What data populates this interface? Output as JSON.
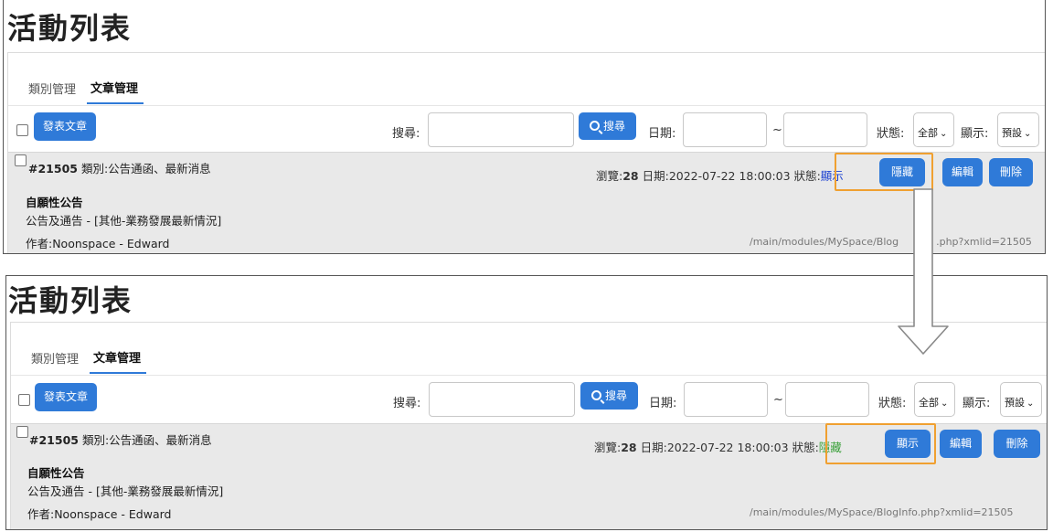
{
  "page": {
    "title": "活動列表",
    "tabs": [
      "類別管理",
      "文章管理"
    ],
    "publish_button": "發表文章",
    "search_label": "搜尋:",
    "search_button": "搜尋",
    "date_label": "日期:",
    "date_separator": "~",
    "status_label": "狀態:",
    "status_select": "全部",
    "display_label": "顯示:",
    "display_select": "預設",
    "article": {
      "id_prefix": "#",
      "id": "21505",
      "category_text": "類別:公告通函、最新消息",
      "views_label": "瀏覽:",
      "views": "28",
      "date_label": "日期:",
      "date": "2022-07-22 18:00:03",
      "status_label": "狀態:",
      "title": "自願性公告",
      "subtitle": "公告及通告 - [其他-業務發展最新情況]",
      "author": "作者:Noonspace - Edward",
      "path": "/main/modules/MySpace/BlogInfo.php?xmlid=21505",
      "edit_button": "編輯",
      "delete_button": "刪除"
    }
  },
  "before": {
    "status_value": "顯示",
    "toggle_button": "隱藏",
    "path_visible": "/main/modules/MySpace/Blog",
    "path_tail": ".php?xmlid=21505"
  },
  "after": {
    "status_value": "隱藏",
    "toggle_button": "顯示"
  },
  "colors": {
    "accent": "#2f7ad8",
    "highlight": "#f0a030",
    "status_visible": "#1a3fd0",
    "status_hidden": "#3aa03a",
    "row_bg": "#e9e9e9"
  },
  "icons": [
    "search-icon",
    "chevron-down-icon",
    "down-arrow-icon",
    "checkbox-icon"
  ]
}
